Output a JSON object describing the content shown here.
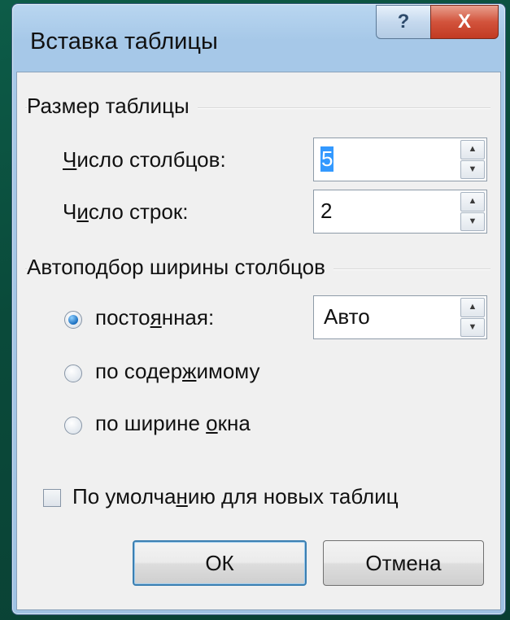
{
  "window": {
    "title": "Вставка таблицы",
    "help_glyph": "?",
    "close_glyph": "X"
  },
  "size_group": {
    "label": "Размер таблицы",
    "columns": {
      "label_pre": "",
      "mnemonic": "Ч",
      "label_post": "исло столбцов:",
      "value": "5"
    },
    "rows": {
      "label_pre": "Ч",
      "mnemonic": "и",
      "label_post": "сло строк:",
      "value": "2"
    }
  },
  "autofit_group": {
    "label": "Автоподбор ширины столбцов",
    "fixed": {
      "label_pre": "посто",
      "mnemonic": "я",
      "label_post": "нная:",
      "value": "Авто",
      "checked": true
    },
    "content": {
      "label_pre": "по содер",
      "mnemonic": "ж",
      "label_post": "имому",
      "checked": false
    },
    "window": {
      "label_pre": "по ширине ",
      "mnemonic": "о",
      "label_post": "кна",
      "checked": false
    }
  },
  "default_checkbox": {
    "label_pre": "По умолча",
    "mnemonic": "н",
    "label_post": "ию для новых таблиц",
    "checked": false
  },
  "buttons": {
    "ok": "ОК",
    "cancel": "Отмена"
  },
  "icons": {
    "spin_up": "▲",
    "spin_down": "▼"
  }
}
